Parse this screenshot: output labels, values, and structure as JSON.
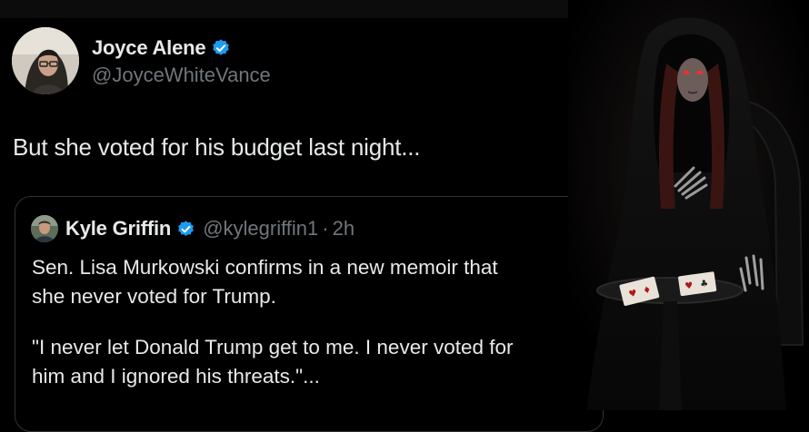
{
  "tweet": {
    "author": {
      "name": "Joyce Alene",
      "handle": "@JoyceWhiteVance",
      "verified_color": "#1d9bf0"
    },
    "text": "But she voted for his budget last night...",
    "quote": {
      "author": {
        "name": "Kyle Griffin",
        "handle": "@kylegriffin1",
        "separator": "·",
        "time": "2h"
      },
      "paragraphs": [
        "Sen. Lisa Murkowski confirms in a new memoir that\nshe never voted for Trump.",
        "\"I never let Donald Trump get to me. I never voted for\nhim and I ignored his threats.\"..."
      ]
    }
  },
  "colors": {
    "background": "#000000",
    "text_primary": "#e7e9ea",
    "text_secondary": "#71767b",
    "border": "#2f3336",
    "accent_red": "#ff2a2a"
  },
  "icons": {
    "verified": "verified-badge-icon",
    "side_image": "hooded-figure-with-cards"
  }
}
